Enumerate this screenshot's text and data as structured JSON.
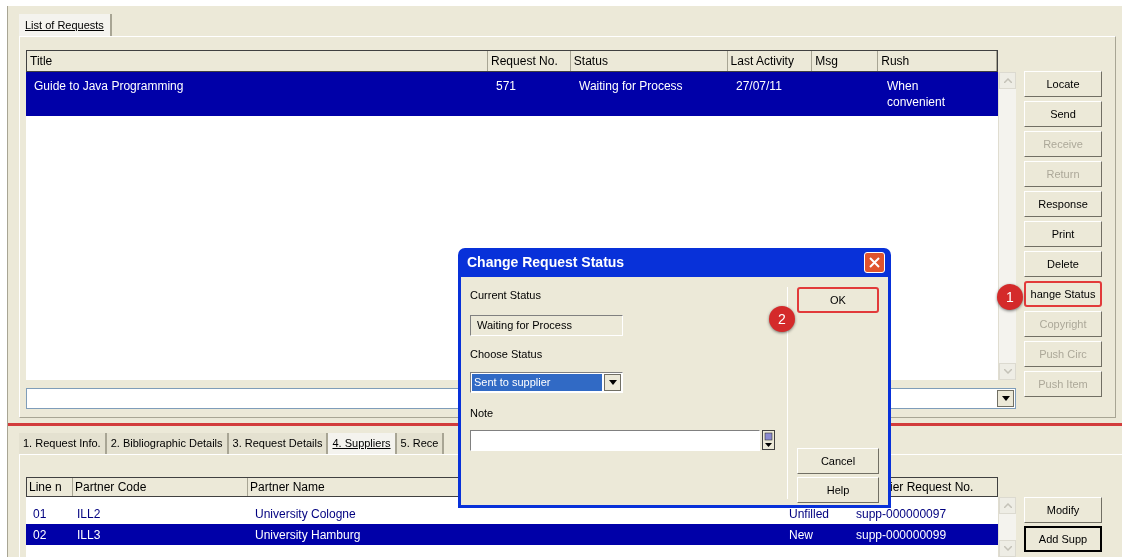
{
  "list_tabs": [
    {
      "label": "List of Requests",
      "selected": true
    }
  ],
  "requests_table": {
    "columns": [
      "Title",
      "Request No.",
      "Status",
      "Last Activity",
      "Msg",
      "Rush"
    ],
    "rows": [
      {
        "title": "Guide to Java Programming",
        "request_no": "571",
        "status": "Waiting for Process",
        "last_activity": "27/07/11",
        "rush": "When convenient",
        "selected": true
      }
    ]
  },
  "actions": [
    {
      "label": "Locate",
      "disabled": false,
      "highlighted": false
    },
    {
      "label": "Send",
      "disabled": false,
      "highlighted": false
    },
    {
      "label": "Receive",
      "disabled": true,
      "highlighted": false
    },
    {
      "label": "Return",
      "disabled": true,
      "highlighted": false
    },
    {
      "label": "Response",
      "disabled": false,
      "highlighted": false
    },
    {
      "label": "Print",
      "disabled": false,
      "highlighted": false
    },
    {
      "label": "Delete",
      "disabled": false,
      "highlighted": false
    },
    {
      "label": "hange Status",
      "disabled": false,
      "highlighted": true
    },
    {
      "label": "Copyright",
      "disabled": true,
      "highlighted": false
    },
    {
      "label": "Push Circ",
      "disabled": true,
      "highlighted": false
    },
    {
      "label": "Push Item",
      "disabled": true,
      "highlighted": false
    }
  ],
  "detail_tabs": [
    {
      "label": "1. Request Info.",
      "selected": false
    },
    {
      "label": "2. Bibliographic Details",
      "selected": false
    },
    {
      "label": "3. Request Details",
      "selected": false
    },
    {
      "label": "4. Suppliers",
      "selected": true
    },
    {
      "label": "5. Rece",
      "selected": false
    }
  ],
  "suppliers_table": {
    "columns": [
      "Line n",
      "Partner Code",
      "Partner Name",
      "ier Request No."
    ],
    "rows": [
      {
        "line": "01",
        "partner_code": "ILL2",
        "partner_name": "University Cologne",
        "status": "Unfilled",
        "supplier_request_no": "supp-000000097",
        "selected": false
      },
      {
        "line": "02",
        "partner_code": "ILL3",
        "partner_name": "University Hamburg",
        "status": "New",
        "supplier_request_no": "supp-000000099",
        "selected": true
      }
    ]
  },
  "supplier_actions": [
    {
      "label": "Modify",
      "default": false
    },
    {
      "label": "Add Supp",
      "default": true
    }
  ],
  "dialog": {
    "title": "Change Request Status",
    "current_status_label": "Current Status",
    "current_status": "Waiting for Process",
    "choose_status_label": "Choose Status",
    "chosen_status": "Sent to supplier",
    "note_label": "Note",
    "buttons": [
      {
        "label": "OK",
        "default": true,
        "highlighted": true
      },
      {
        "label": "Cancel",
        "default": false,
        "highlighted": false
      },
      {
        "label": "Help",
        "default": false,
        "highlighted": false
      }
    ]
  },
  "callouts": [
    {
      "number": "1"
    },
    {
      "number": "2"
    }
  ]
}
